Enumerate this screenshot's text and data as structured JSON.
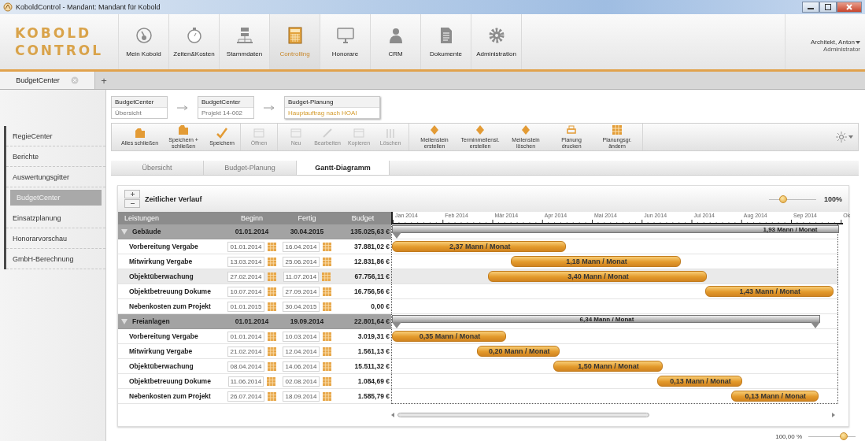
{
  "window": {
    "title": "KoboldControl - Mandant: Mandant für Kobold"
  },
  "logo": {
    "lines": [
      "KOBOLD",
      "CONTROL"
    ]
  },
  "nav": [
    {
      "label": "Mein Kobold",
      "selected": false
    },
    {
      "label": "Zeiten&Kosten",
      "selected": false
    },
    {
      "label": "Stammdaten",
      "selected": false
    },
    {
      "label": "Controlling",
      "selected": true
    },
    {
      "label": "Honorare",
      "selected": false
    },
    {
      "label": "CRM",
      "selected": false
    },
    {
      "label": "Dokumente",
      "selected": false
    },
    {
      "label": "Administration",
      "selected": false
    }
  ],
  "user": {
    "name": "Architekt, Anton",
    "role": "Administrator"
  },
  "doc_tabs": [
    {
      "label": "BudgetCenter",
      "selected": true
    }
  ],
  "new_tab": "+",
  "sidebar": {
    "items": [
      {
        "label": "RegieCenter",
        "selected": false
      },
      {
        "label": "Berichte",
        "selected": false
      },
      {
        "label": "Auswertungsgitter",
        "selected": false
      },
      {
        "label": "BudgetCenter",
        "selected": true
      },
      {
        "label": "Einsatzplanung",
        "selected": false
      },
      {
        "label": "Honorarvorschau",
        "selected": false
      },
      {
        "label": "GmbH-Berechnung",
        "selected": false
      }
    ]
  },
  "breadcrumb": [
    {
      "title": "BudgetCenter",
      "subtitle": "Übersicht",
      "current": false
    },
    {
      "title": "BudgetCenter",
      "subtitle": "Projekt 14-002",
      "current": false
    },
    {
      "title": "Budget-Planung",
      "subtitle": "Hauptauftrag nach HOAI",
      "current": true
    }
  ],
  "toolbar": {
    "groups": [
      {
        "buttons": [
          {
            "label": "Alles schließen",
            "disabled": false
          },
          {
            "label": "Speichern + schließen",
            "disabled": false
          },
          {
            "label": "Speichern",
            "disabled": false
          }
        ]
      },
      {
        "buttons": [
          {
            "label": "Öffnen",
            "disabled": true
          }
        ]
      },
      {
        "buttons": [
          {
            "label": "Neu",
            "disabled": true
          },
          {
            "label": "Bearbeiten",
            "disabled": true
          },
          {
            "label": "Kopieren",
            "disabled": true
          },
          {
            "label": "Löschen",
            "disabled": true
          }
        ]
      },
      {
        "buttons": [
          {
            "label": "Meilenstein erstellen",
            "disabled": false
          },
          {
            "label": "Terminmeilenst. erstellen",
            "disabled": false
          },
          {
            "label": "Meilenstein löschen",
            "disabled": false
          },
          {
            "label": "Planung drucken",
            "disabled": false
          },
          {
            "label": "Planungsgr. ändern",
            "disabled": false
          }
        ]
      }
    ]
  },
  "view_tabs": [
    {
      "label": "Übersicht",
      "selected": false
    },
    {
      "label": "Budget-Planung",
      "selected": false
    },
    {
      "label": "Gantt-Diagramm",
      "selected": true
    }
  ],
  "gantt": {
    "title": "Zeitlicher Verlauf",
    "zoom": {
      "level": 0.3,
      "reading": "100%"
    },
    "columns": [
      "Leistungen",
      "Beginn",
      "Fertig",
      "Budget"
    ],
    "months": [
      "Jan 2014",
      "Feb 2014",
      "Mär 2014",
      "Apr 2014",
      "Mai 2014",
      "Jun 2014",
      "Jul 2014",
      "Aug 2014",
      "Sep 2014",
      "Ok"
    ],
    "groups": [
      {
        "name": "Gebäude",
        "begin": "01.01.2014",
        "end": "30.04.2015",
        "budget": "135.025,63 €",
        "bar_label": "1,93 Mann / Monat",
        "expanded": true,
        "children": [
          {
            "name": "Vorbereitung Vergabe",
            "begin": "01.01.2014",
            "end": "16.04.2014",
            "budget": "37.881,02 €",
            "bar_label": "2,37 Mann / Monat",
            "selected": false
          },
          {
            "name": "Mitwirkung Vergabe",
            "begin": "13.03.2014",
            "end": "25.06.2014",
            "budget": "12.831,86 €",
            "bar_label": "1,18 Mann / Monat",
            "selected": false
          },
          {
            "name": "Objektüberwachung",
            "begin": "27.02.2014",
            "end": "11.07.2014",
            "budget": "67.756,11 €",
            "bar_label": "3,40 Mann / Monat",
            "selected": true
          },
          {
            "name": "Objektbetreuung Dokume",
            "begin": "10.07.2014",
            "end": "27.09.2014",
            "budget": "16.756,56 €",
            "bar_label": "1,43 Mann / Monat",
            "selected": false
          },
          {
            "name": "Nebenkosten zum Projekt",
            "begin": "01.01.2015",
            "end": "30.04.2015",
            "budget": "0,00 €",
            "selected": false
          }
        ]
      },
      {
        "name": "Freianlagen",
        "begin": "01.01.2014",
        "end": "19.09.2014",
        "budget": "22.801,64 €",
        "bar_label": "6,34 Mann / Monat",
        "expanded": true,
        "children": [
          {
            "name": "Vorbereitung Vergabe",
            "begin": "01.01.2014",
            "end": "10.03.2014",
            "budget": "3.019,31 €",
            "bar_label": "0,35 Mann / Monat",
            "selected": false
          },
          {
            "name": "Mitwirkung Vergabe",
            "begin": "21.02.2014",
            "end": "12.04.2014",
            "budget": "1.561,13 €",
            "bar_label": "0,20 Mann / Monat",
            "selected": false
          },
          {
            "name": "Objektüberwachung",
            "begin": "08.04.2014",
            "end": "14.06.2014",
            "budget": "15.511,32 €",
            "bar_label": "1,50 Mann / Monat",
            "selected": false
          },
          {
            "name": "Objektbetreuung Dokume",
            "begin": "11.06.2014",
            "end": "02.08.2014",
            "budget": "1.084,69 €",
            "bar_label": "0,13 Mann / Monat",
            "selected": false
          },
          {
            "name": "Nebenkosten zum Projekt",
            "begin": "26.07.2014",
            "end": "18.09.2014",
            "budget": "1.585,79 €",
            "bar_label": "0,13 Mann / Monat",
            "selected": false
          }
        ]
      }
    ]
  },
  "status_bar": {
    "zoom_reading": "100,00 %",
    "level": 0.75
  }
}
